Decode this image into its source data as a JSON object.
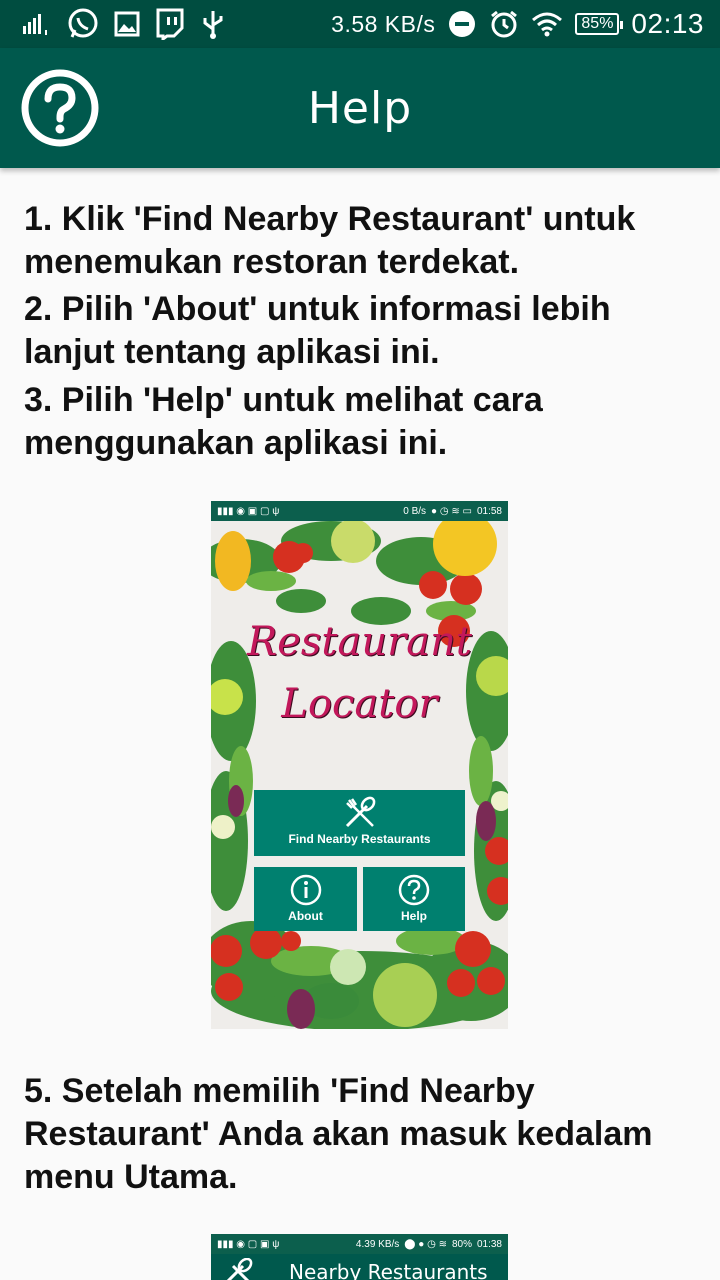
{
  "status_bar": {
    "net_speed": "3.58 KB/s",
    "battery": "85%",
    "time": "02:13",
    "icons": [
      "signal-icon",
      "whatsapp-icon",
      "gallery-icon",
      "twitch-icon",
      "usb-icon",
      "dnd-icon",
      "alarm-icon",
      "wifi-icon",
      "battery-icon"
    ]
  },
  "toolbar": {
    "title": "Help",
    "icon": "help-circle-icon",
    "background": "#00594d"
  },
  "steps": [
    "1. Klik 'Find Nearby Restaurant' untuk menemukan restoran terdekat.",
    "2. Pilih 'About' untuk informasi lebih lanjut tentang aplikasi ini.",
    "3. Pilih 'Help' untuk melihat cara menggunakan aplikasi ini.",
    "5. Setelah memilih 'Find Nearby Restaurant' Anda akan masuk kedalam menu Utama."
  ],
  "screenshot1": {
    "status_speed": "0 B/s",
    "status_time": "01:58",
    "title_line1": "Restaurant",
    "title_line2": "Locator",
    "find_button": "Find Nearby Restaurants",
    "about_button": "About",
    "help_button": "Help"
  },
  "screenshot2": {
    "status_speed": "4.39 KB/s",
    "status_battery": "80%",
    "status_time": "01:38",
    "title": "Nearby Restaurants"
  }
}
